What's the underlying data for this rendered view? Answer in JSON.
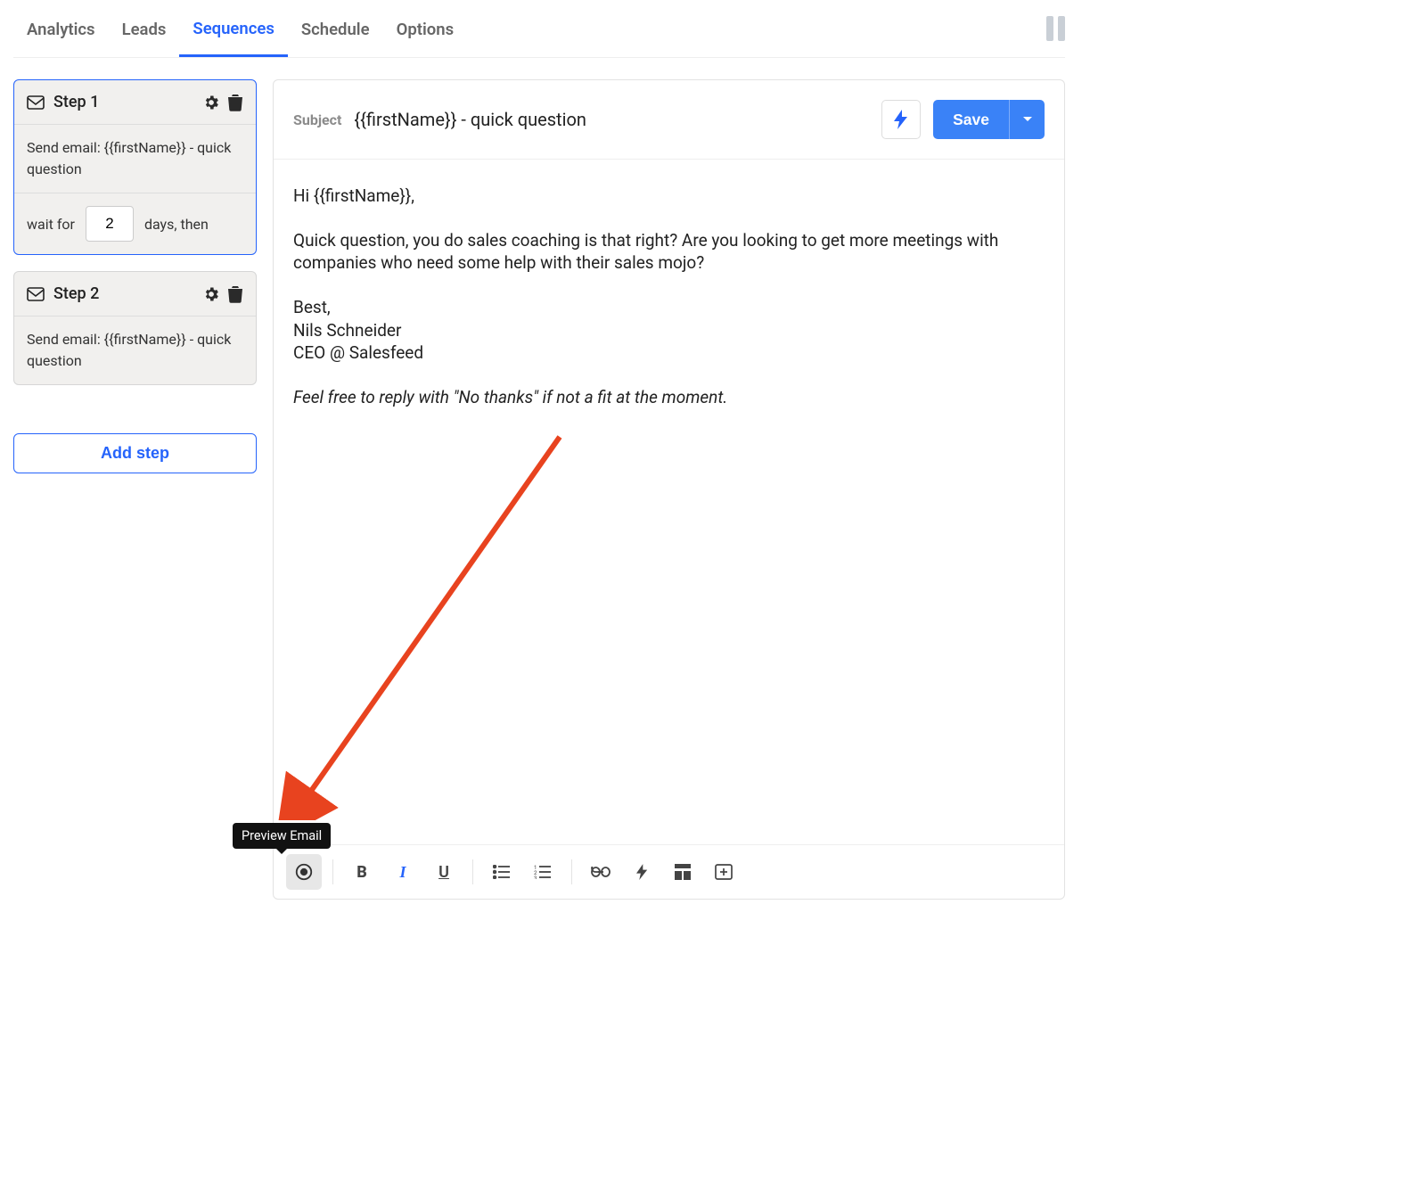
{
  "tabs": {
    "analytics": "Analytics",
    "leads": "Leads",
    "sequences": "Sequences",
    "schedule": "Schedule",
    "options": "Options"
  },
  "steps": [
    {
      "title": "Step 1",
      "body": "Send email: {{firstName}} - quick question",
      "wait_prefix": "wait for",
      "wait_value": "2",
      "wait_suffix": "days, then"
    },
    {
      "title": "Step 2",
      "body": "Send email: {{firstName}} - quick question"
    }
  ],
  "add_step_label": "Add step",
  "subject": {
    "label": "Subject",
    "value": "{{firstName}} - quick question"
  },
  "save_label": "Save",
  "email": {
    "greeting": "Hi {{firstName}},",
    "para1": "Quick question, you do sales coaching is that right? Are you looking to get more meetings with companies who need some help with their sales mojo?",
    "closing_best": "Best,",
    "closing_name": "Nils Schneider",
    "closing_title": "CEO @ Salesfeed",
    "ps": "Feel free to reply with \"No thanks\" if not a fit at the moment."
  },
  "tooltip_preview": "Preview Email"
}
